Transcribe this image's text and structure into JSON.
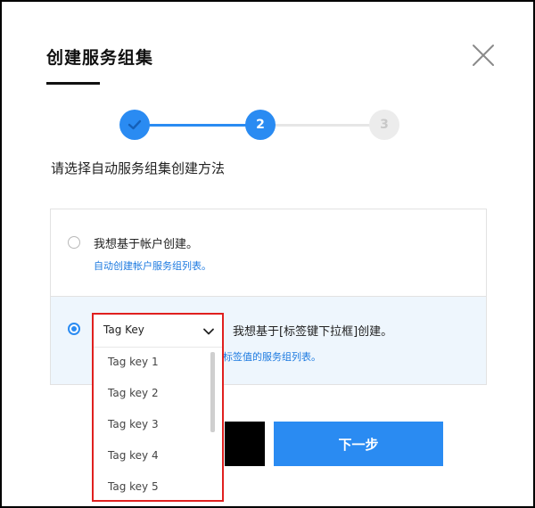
{
  "dialog": {
    "title": "创建服务组集"
  },
  "stepper": {
    "step2": "2",
    "step3": "3"
  },
  "subtitle": "请选择自动服务组集创建方法",
  "options": [
    {
      "label": "我想基于帐户创建。",
      "link": "自动创建帐户服务组列表。",
      "selected": false
    },
    {
      "label": "我想基于[标签键下拉框]创建。",
      "link_partial": "标签值的服务组列表。",
      "selected": true
    }
  ],
  "dropdown": {
    "selected": "Tag Key",
    "items": [
      "Tag key 1",
      "Tag key 2",
      "Tag key 3",
      "Tag key 4",
      "Tag key 5"
    ]
  },
  "buttons": {
    "next": "下一步"
  },
  "colors": {
    "accent": "#2a8bf2",
    "highlight_border": "#e0201f",
    "link": "#1d7ae0"
  }
}
